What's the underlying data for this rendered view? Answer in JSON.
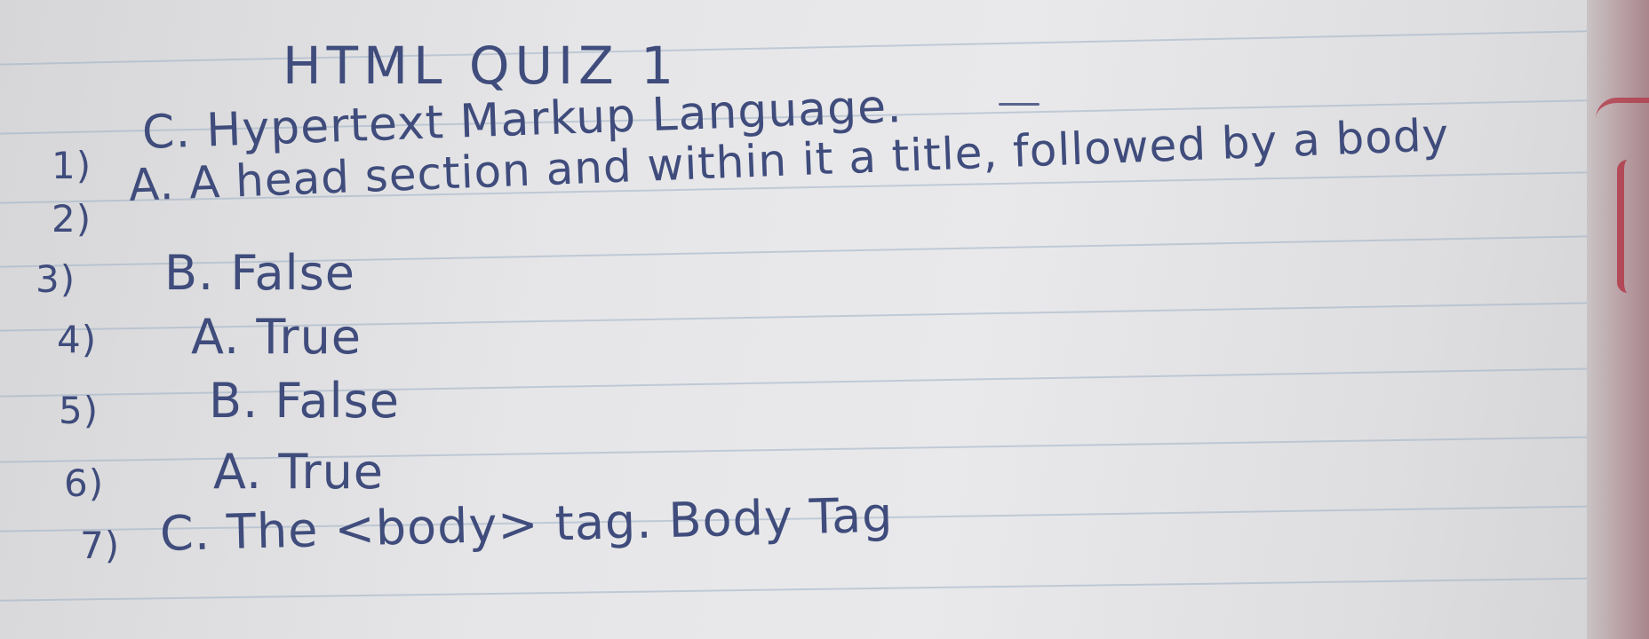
{
  "document": {
    "title": "HTML QUIZ 1",
    "answers": [
      {
        "number": "1)",
        "text": "C. Hypertext Markup Language."
      },
      {
        "number": "2)",
        "text": "A. A head section and within it a title, followed by a body"
      },
      {
        "number": "3)",
        "text": "B. False"
      },
      {
        "number": "4)",
        "text": "A. True"
      },
      {
        "number": "5)",
        "text": "B. False"
      },
      {
        "number": "6)",
        "text": "A. True"
      },
      {
        "number": "7)",
        "text": "C. The <body> tag. Body Tag"
      }
    ]
  },
  "colors": {
    "ink": "#3f4c7c",
    "paper": "#e6e6e8",
    "rule_lines": "#9fb0c4",
    "margin_red": "#b33b4a"
  }
}
